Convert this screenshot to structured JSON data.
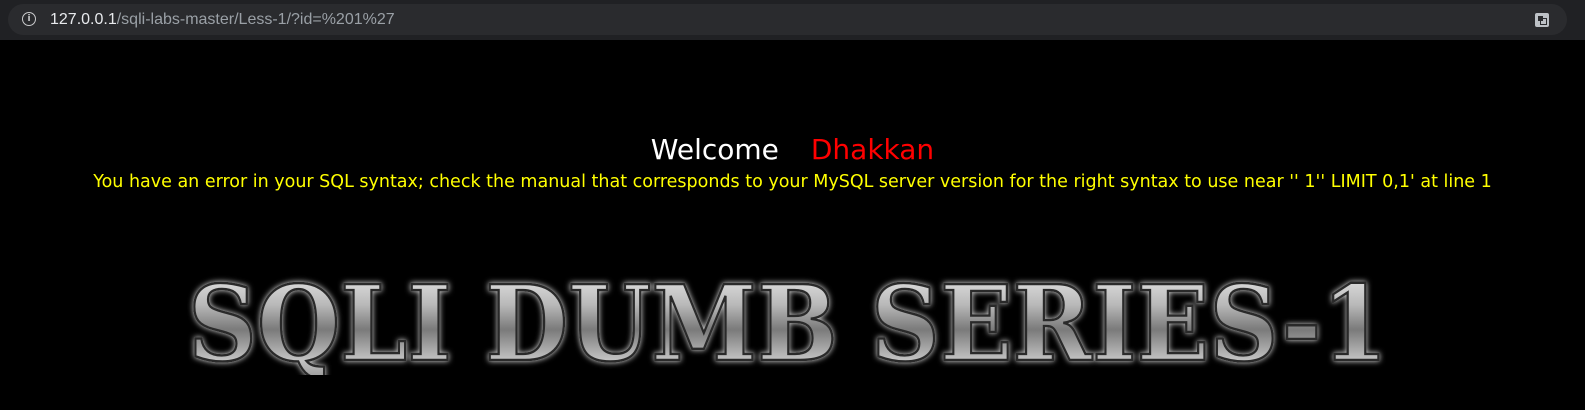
{
  "browser": {
    "url_host": "127.0.0.1",
    "url_path": "/sqli-labs-master/Less-1/?id=%201%27",
    "info_icon": "info-icon",
    "translate_icon": "translate-icon"
  },
  "page": {
    "welcome": "Welcome",
    "username": "Dhakkan",
    "error_message": "You have an error in your SQL syntax; check the manual that corresponds to your MySQL server version for the right syntax to use near '' 1'' LIMIT 0,1' at line 1",
    "logo_text": "SQLI DUMB SERIES-1"
  },
  "colors": {
    "background": "#000000",
    "welcome": "#ffffff",
    "username": "#ff0000",
    "error": "#ffff00"
  }
}
